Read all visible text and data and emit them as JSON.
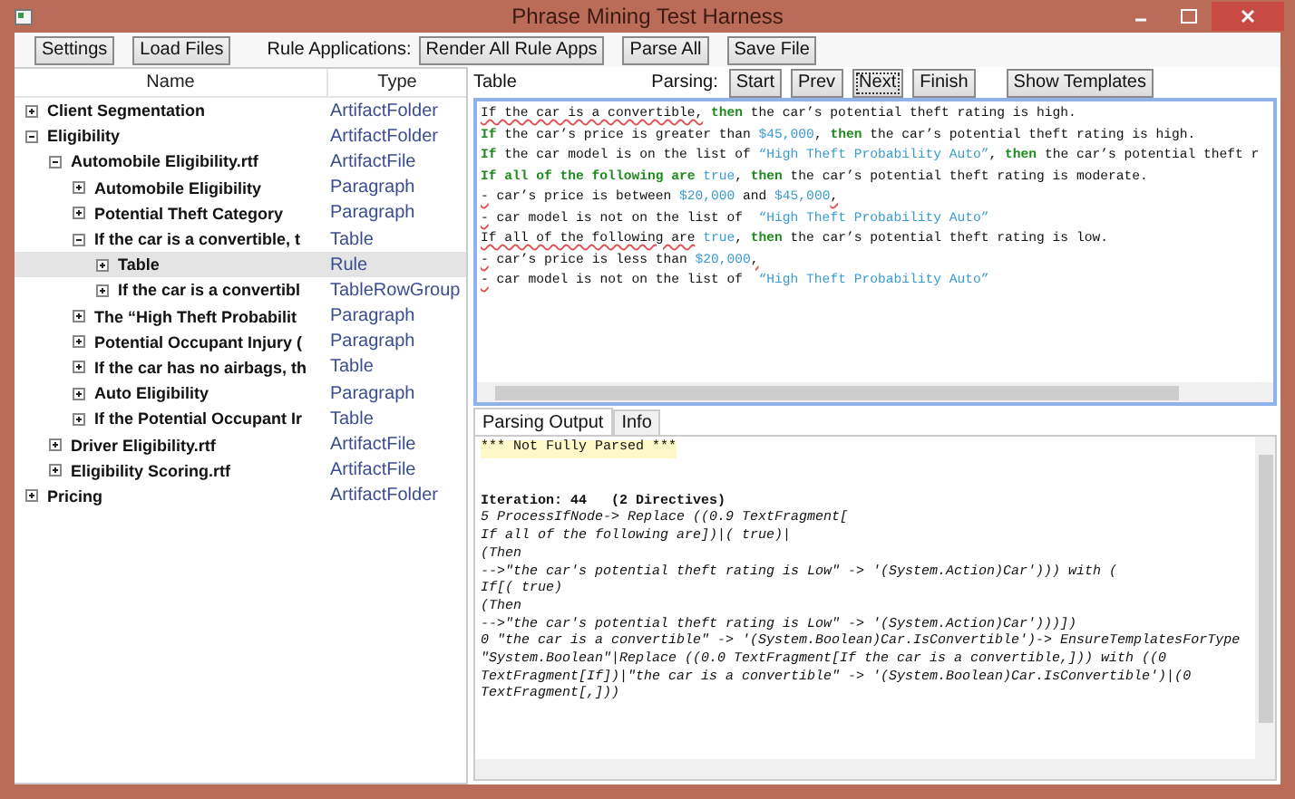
{
  "window": {
    "title": "Phrase Mining Test Harness"
  },
  "toolbar": {
    "buttons": [
      {
        "label": "Settings"
      },
      {
        "label": "Load Files"
      }
    ],
    "rule_label": "Rule Applications:",
    "rule_buttons": [
      {
        "label": "Render All Rule Apps"
      },
      {
        "label": "Parse All"
      },
      {
        "label": "Save File"
      }
    ]
  },
  "tree": {
    "columns": [
      "Name",
      "Type"
    ],
    "items": [
      {
        "name": "Client Segmentation",
        "type": "ArtifactFolder",
        "expanded": false,
        "selected": false
      },
      {
        "name": "Eligibility",
        "type": "ArtifactFolder",
        "expanded": true,
        "selected": false,
        "children": [
          {
            "name": "Automobile Eligibility.rtf",
            "type": "ArtifactFile",
            "expanded": true,
            "selected": false,
            "children": [
              {
                "name": "Automobile Eligibility",
                "type": "Paragraph",
                "expanded": false,
                "selected": false
              },
              {
                "name": "Potential Theft Category",
                "type": "Paragraph",
                "expanded": false,
                "selected": false
              },
              {
                "name": "If the car is a convertible, t",
                "type": "Table",
                "expanded": true,
                "selected": false,
                "children": [
                  {
                    "name": "Table",
                    "type": "Rule",
                    "expanded": false,
                    "selected": true
                  },
                  {
                    "name": "If the car is a convertibl",
                    "type": "TableRowGroup",
                    "expanded": false,
                    "selected": false
                  }
                ]
              },
              {
                "name": "The “High Theft Probabilit",
                "type": "Paragraph",
                "expanded": false,
                "selected": false
              },
              {
                "name": "Potential Occupant Injury (",
                "type": "Paragraph",
                "expanded": false,
                "selected": false
              },
              {
                "name": "If the car has no airbags, th",
                "type": "Table",
                "expanded": false,
                "selected": false
              },
              {
                "name": "Auto Eligibility",
                "type": "Paragraph",
                "expanded": false,
                "selected": false
              },
              {
                "name": "If the Potential Occupant Ir",
                "type": "Table",
                "expanded": false,
                "selected": false
              }
            ]
          },
          {
            "name": "Driver Eligibility.rtf",
            "type": "ArtifactFile",
            "expanded": false,
            "selected": false
          },
          {
            "name": "Eligibility Scoring.rtf",
            "type": "ArtifactFile",
            "expanded": false,
            "selected": false
          }
        ]
      },
      {
        "name": "Pricing",
        "type": "ArtifactFolder",
        "expanded": false,
        "selected": false
      }
    ]
  },
  "editor": {
    "heading": "Table",
    "parsing_label": "Parsing:",
    "parsing_buttons": [
      {
        "label": "Start",
        "focused": false
      },
      {
        "label": "Prev",
        "focused": false
      },
      {
        "label": "Next",
        "focused": true
      },
      {
        "label": "Finish",
        "focused": false
      }
    ],
    "templates_button": "Show Templates",
    "lines": [
      [
        {
          "kind": "flagged",
          "text": "If the car is a convertible,"
        },
        {
          "kind": "keyword",
          "text": " then"
        },
        {
          "kind": "text",
          "text": " the car’s potential theft rating is high."
        }
      ],
      [
        {
          "kind": "keyword",
          "text": "If"
        },
        {
          "kind": "text",
          "text": " the car’s price is greater than "
        },
        {
          "kind": "value",
          "text": "$45,000"
        },
        {
          "kind": "text",
          "text": ", "
        },
        {
          "kind": "keyword",
          "text": "then"
        },
        {
          "kind": "text",
          "text": " the car’s potential theft rating is high."
        }
      ],
      [
        {
          "kind": "keyword",
          "text": "If"
        },
        {
          "kind": "text",
          "text": " the car model is on the list of "
        },
        {
          "kind": "value",
          "text": "“High Theft Probability Auto”"
        },
        {
          "kind": "text",
          "text": ", "
        },
        {
          "kind": "keyword",
          "text": "then"
        },
        {
          "kind": "text",
          "text": " the car’s potential theft r"
        }
      ],
      [
        {
          "kind": "keyword",
          "text": "If all of the following are"
        },
        {
          "kind": "value",
          "text": " true"
        },
        {
          "kind": "text",
          "text": ", "
        },
        {
          "kind": "keyword",
          "text": "then"
        },
        {
          "kind": "text",
          "text": " the car’s potential theft rating is moderate."
        }
      ],
      [
        {
          "kind": "flagged",
          "text": "-"
        },
        {
          "kind": "text",
          "text": " car’s price is between "
        },
        {
          "kind": "value",
          "text": "$20,000"
        },
        {
          "kind": "text",
          "text": " and "
        },
        {
          "kind": "value",
          "text": "$45,000"
        },
        {
          "kind": "flagged",
          "text": ","
        }
      ],
      [
        {
          "kind": "flagged",
          "text": "-"
        },
        {
          "kind": "text",
          "text": " car model is not on the list of  "
        },
        {
          "kind": "value",
          "text": "“High Theft Probability Auto”"
        }
      ],
      [
        {
          "kind": "flagged",
          "text": "If all of the following are"
        },
        {
          "kind": "value",
          "text": " true"
        },
        {
          "kind": "text",
          "text": ", "
        },
        {
          "kind": "keyword",
          "text": "then"
        },
        {
          "kind": "text",
          "text": " the car’s potential theft rating is low."
        }
      ],
      [
        {
          "kind": "flagged",
          "text": "-"
        },
        {
          "kind": "text",
          "text": " car’s price is less than "
        },
        {
          "kind": "value",
          "text": "$20,000"
        },
        {
          "kind": "flagged",
          "text": ","
        }
      ],
      [
        {
          "kind": "flagged",
          "text": "-"
        },
        {
          "kind": "text",
          "text": " car model is not on the list of  "
        },
        {
          "kind": "value",
          "text": "“High Theft Probability Auto”"
        }
      ]
    ]
  },
  "output": {
    "tabs": [
      {
        "label": "Parsing Output",
        "selected": true
      },
      {
        "label": "Info",
        "selected": false
      }
    ],
    "blocks": [
      {
        "kind": "banner",
        "text": "*** Not Fully Parsed ***"
      },
      {
        "kind": "heading",
        "text": "Iteration: 44   (2 Directives)"
      },
      {
        "kind": "trace",
        "text": "5 ProcessIfNode-> Replace ((0.9 TextFragment[\nIf all of the following are])|( true)|\n(Then\n-->\"the car's potential theft rating is Low\" -> '(System.Action)Car'))) with (\nIf[( true)\n(Then\n-->\"the car's potential theft rating is Low\" -> '(System.Action)Car')))])\n0 \"the car is a convertible\" -> '(System.Boolean)Car.IsConvertible')-> EnsureTemplatesForType\n\"System.Boolean\"|Replace ((0.0 TextFragment[If the car is a convertible,])) with ((0\nTextFragment[If])|\"the car is a convertible\" -> '(System.Boolean)Car.IsConvertible')|(0\nTextFragment[,]))"
      }
    ]
  }
}
